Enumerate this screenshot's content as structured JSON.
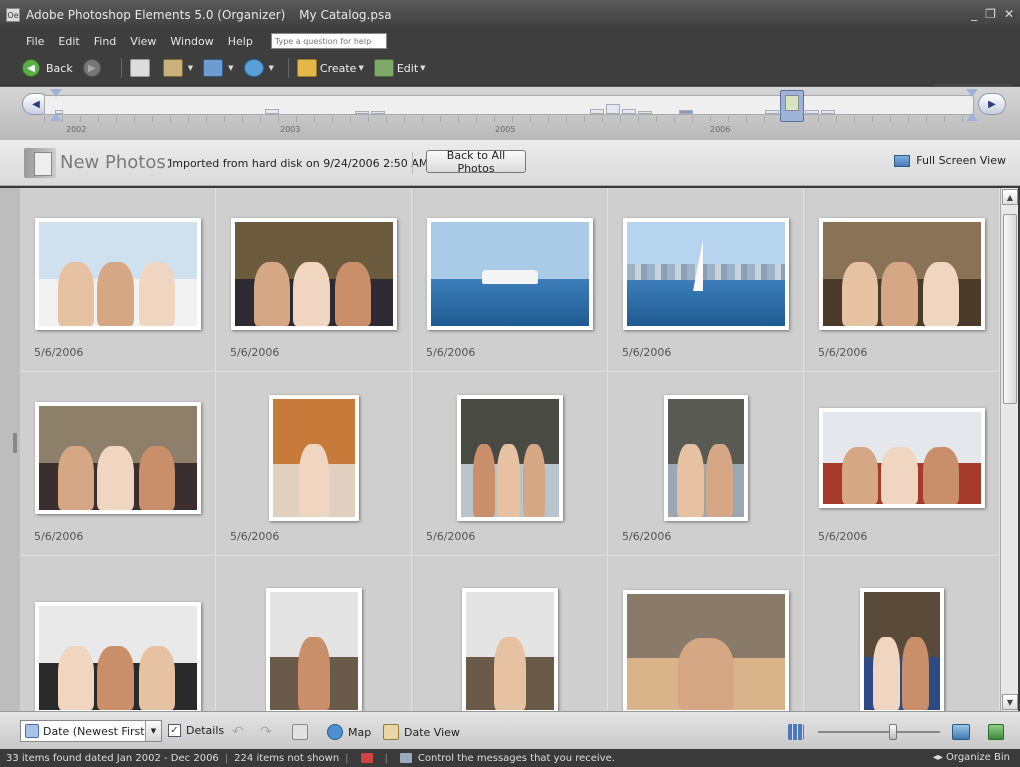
{
  "window": {
    "app_title": "Adobe Photoshop Elements 5.0 (Organizer)",
    "catalog": "My Catalog.psa",
    "min": "_",
    "restore": "❐",
    "close": "✕"
  },
  "menu": {
    "items": [
      "File",
      "Edit",
      "Find",
      "View",
      "Window",
      "Help"
    ],
    "help_placeholder": "Type a question for help"
  },
  "toolbar": {
    "back_label": "Back",
    "create_label": "Create",
    "edit_label": "Edit"
  },
  "timeline": {
    "years": [
      "2002",
      "2003",
      "2005",
      "2006"
    ]
  },
  "header": {
    "title": "New Photos:",
    "subtitle": "Imported from hard disk on 9/24/2006 2:50 AM",
    "back_button": "Back to All Photos",
    "full_screen": "Full Screen View"
  },
  "photos": [
    {
      "date": "5/6/2006",
      "scene": "boat-interior",
      "sky": "#cfe0ee",
      "base": "#f2f2f2"
    },
    {
      "date": "5/6/2006",
      "scene": "restaurant",
      "sky": "#6b5a3e",
      "base": "#2e2a33"
    },
    {
      "date": "5/6/2006",
      "scene": "yacht-sea",
      "sky": "#a9cbe8",
      "base": "#2f6ea8"
    },
    {
      "date": "5/6/2006",
      "scene": "sailboat-city",
      "sky": "#b7d4ee",
      "base": "#3a78b5"
    },
    {
      "date": "5/6/2006",
      "scene": "bar-group",
      "sky": "#8a7256",
      "base": "#4a3a2a"
    },
    {
      "date": "5/6/2006",
      "scene": "party-room",
      "sky": "#8e7f6a",
      "base": "#3a2e2e"
    },
    {
      "date": "5/6/2006",
      "scene": "dancer",
      "sky": "#c77a3a",
      "base": "#e0d0c0"
    },
    {
      "date": "5/6/2006",
      "scene": "cake",
      "sky": "#4a4a44",
      "base": "#b9c4cc"
    },
    {
      "date": "5/6/2006",
      "scene": "couple",
      "sky": "#5a5a55",
      "base": "#9aa8b5"
    },
    {
      "date": "5/6/2006",
      "scene": "marina-group",
      "sky": "#e4e8ec",
      "base": "#a33a2a"
    },
    {
      "date": "",
      "scene": "patio-lunch",
      "sky": "#e9e9e9",
      "base": "#2a2a2a"
    },
    {
      "date": "",
      "scene": "photographer",
      "sky": "#e4e4e4",
      "base": "#6a5a4a"
    },
    {
      "date": "",
      "scene": "photographer",
      "sky": "#e4e4e4",
      "base": "#6a5a4a"
    },
    {
      "date": "",
      "scene": "camera-closeup",
      "sky": "#8a7a6a",
      "base": "#d9b48a"
    },
    {
      "date": "",
      "scene": "couple-2",
      "sky": "#5a4a3a",
      "base": "#2c4a86"
    }
  ],
  "bottom": {
    "sort": "Date (Newest First)",
    "details": "Details",
    "map": "Map",
    "date_view": "Date View"
  },
  "status": {
    "found": "33 items found dated Jan 2002 - Dec 2006",
    "not_shown": "224 items not shown",
    "message": "Control the messages that you receive.",
    "organize": "Organize Bin"
  },
  "colors": {
    "accent": "#5cae4a",
    "chrome": "#3e3e3e",
    "grid": "#cfcfcf"
  }
}
